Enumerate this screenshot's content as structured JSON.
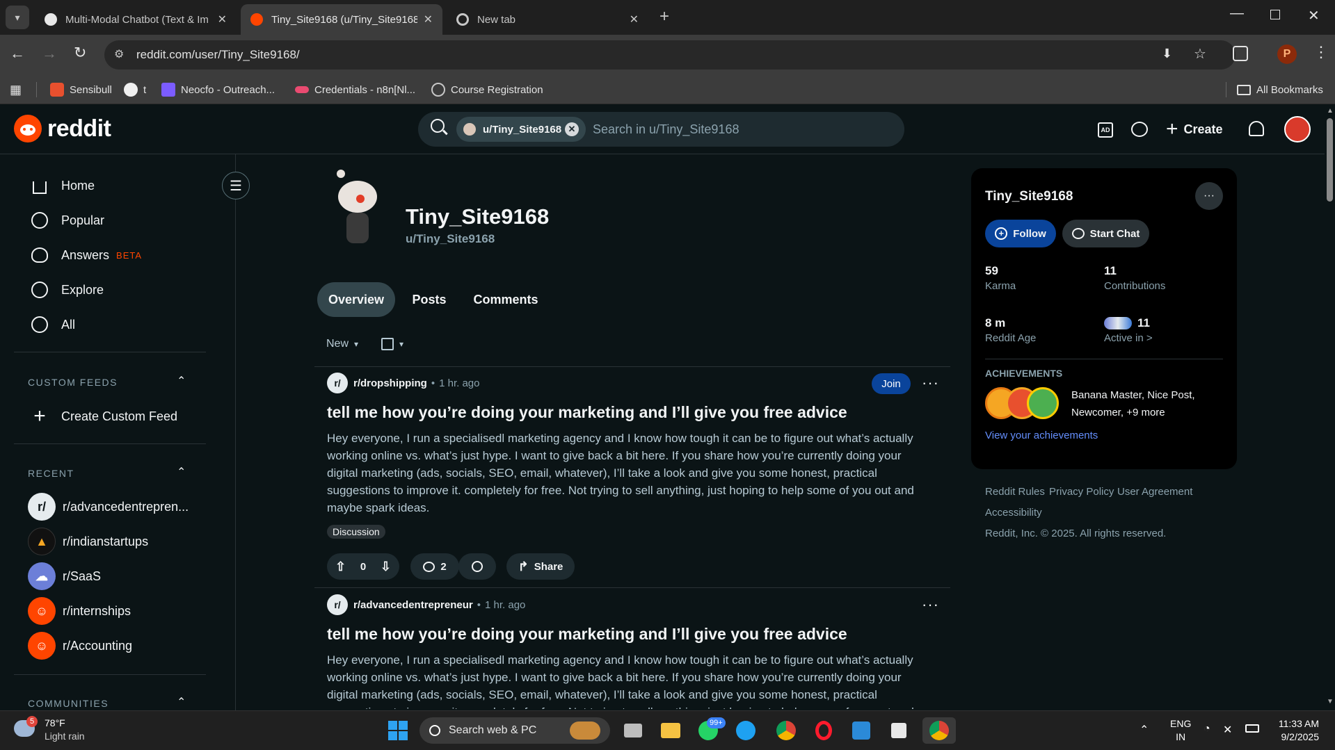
{
  "browser": {
    "tabs": [
      {
        "title": "Multi-Modal Chatbot (Text & Im",
        "active": false
      },
      {
        "title": "Tiny_Site9168 (u/Tiny_Site9168)",
        "active": true
      },
      {
        "title": "New tab",
        "active": false
      }
    ],
    "url": "reddit.com/user/Tiny_Site9168/",
    "bookmarks": [
      "Sensibull",
      "t",
      "Neocfo - Outreach...",
      "Credentials - n8n[Nl...",
      "Course Registration"
    ],
    "all_bookmarks": "All Bookmarks",
    "profile_initial": "P"
  },
  "header": {
    "logo": "reddit",
    "search_chip": "u/Tiny_Site9168",
    "search_placeholder": "Search in u/Tiny_Site9168",
    "create_label": "Create"
  },
  "sidebar": {
    "nav": [
      {
        "label": "Home",
        "icon": "home-icon"
      },
      {
        "label": "Popular",
        "icon": "popular-icon"
      },
      {
        "label": "Answers",
        "badge": "BETA",
        "icon": "answers-icon"
      },
      {
        "label": "Explore",
        "icon": "explore-icon"
      },
      {
        "label": "All",
        "icon": "all-icon"
      }
    ],
    "custom_feeds_heading": "CUSTOM FEEDS",
    "create_custom_feed": "Create Custom Feed",
    "recent_heading": "RECENT",
    "recent": [
      "r/advancedentrepren...",
      "r/indianstartups",
      "r/SaaS",
      "r/internships",
      "r/Accounting"
    ],
    "communities_heading": "COMMUNITIES"
  },
  "profile": {
    "display_name": "Tiny_Site9168",
    "username": "u/Tiny_Site9168",
    "tabs": [
      "Overview",
      "Posts",
      "Comments"
    ],
    "sort": "New"
  },
  "posts": [
    {
      "subreddit": "r/dropshipping",
      "time": "1 hr. ago",
      "join": "Join",
      "title": "tell me how you’re doing your marketing and I’ll give you free advice",
      "body": "Hey everyone, I run a specialisedl marketing agency and I know how tough it can be to figure out what’s actually working online vs. what’s just hype. I want to give back a bit here. If you share how you’re currently doing your digital marketing (ads, socials, SEO, email, whatever), I’ll take a look and give you some honest, practical suggestions to improve it. completely for free. Not trying to sell anything, just hoping to help some of you out and maybe spark ideas.",
      "flair": "Discussion",
      "votes": "0",
      "comments": "2",
      "share": "Share"
    },
    {
      "subreddit": "r/advancedentrepreneur",
      "time": "1 hr. ago",
      "title": "tell me how you’re doing your marketing and I’ll give you free advice",
      "body": "Hey everyone, I run a specialisedl marketing agency and I know how tough it can be to figure out what’s actually working online vs. what’s just hype. I want to give back a bit here. If you share how you’re currently doing your digital marketing (ads, socials, SEO, email, whatever), I’ll take a look and give you some honest, practical suggestions to improve it. completely for free. Not trying to sell anything, just hoping to help some of you out and maybe spark ideas."
    }
  ],
  "card": {
    "name": "Tiny_Site9168",
    "follow": "Follow",
    "start_chat": "Start Chat",
    "karma_value": "59",
    "karma_label": "Karma",
    "contrib_value": "11",
    "contrib_label": "Contributions",
    "age_value": "8 m",
    "age_label": "Reddit Age",
    "active_value": "11",
    "active_label": "Active in >",
    "achievements_heading": "ACHIEVEMENTS",
    "achievements_line1": "Banana Master, Nice Post,",
    "achievements_line2": "Newcomer, +9 more",
    "view_achievements": "View your achievements"
  },
  "footer_links": {
    "rules": "Reddit Rules",
    "privacy": "Privacy Policy",
    "agreement": "User Agreement",
    "accessibility": "Accessibility",
    "copyright": "Reddit, Inc. © 2025. All rights reserved."
  },
  "taskbar": {
    "weather_temp": "78°F",
    "weather_desc": "Light rain",
    "weather_badge": "5",
    "search": "Search web & PC",
    "whatsapp_badge": "99+",
    "lang1": "ENG",
    "lang2": "IN",
    "time": "11:33 AM",
    "date": "9/2/2025"
  },
  "colors": {
    "accent_blue": "#0a449b",
    "link_blue": "#648efc",
    "reddit_orange": "#ff4500",
    "beta_red": "#ff4500"
  }
}
